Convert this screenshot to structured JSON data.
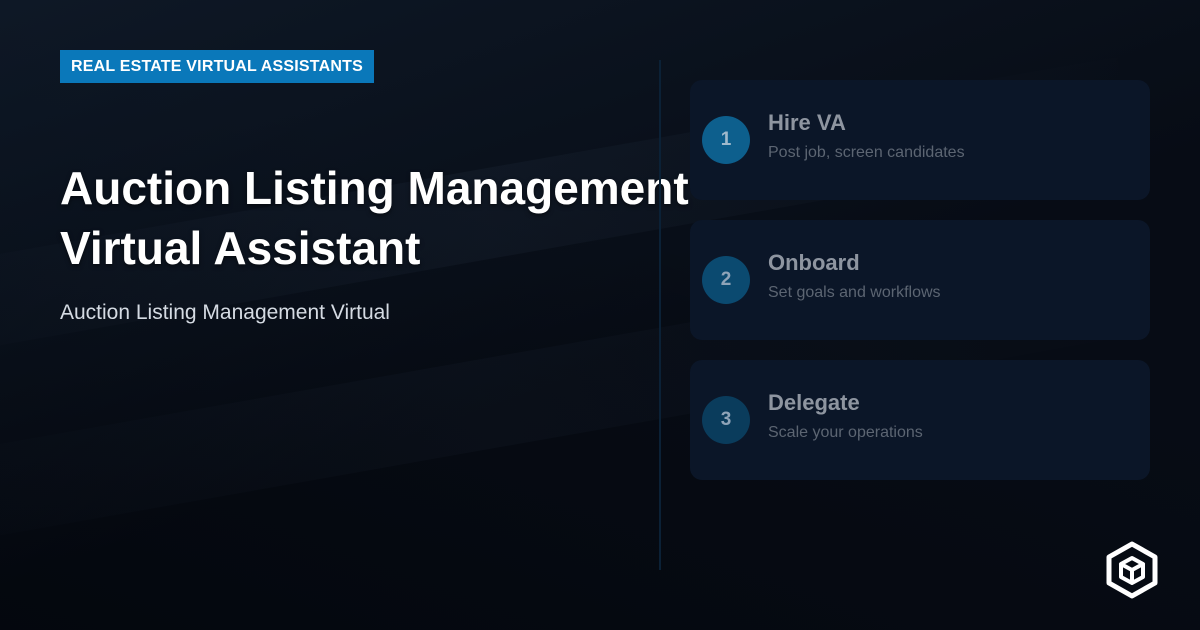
{
  "badge": "REAL ESTATE VIRTUAL ASSISTANTS",
  "title": "Auction Listing Management Virtual Assistant",
  "subtitle": "Auction Listing Management Virtual",
  "steps": [
    {
      "number": "1",
      "title": "Hire VA",
      "description": "Post job, screen candidates"
    },
    {
      "number": "2",
      "title": "Onboard",
      "description": "Set goals and workflows"
    },
    {
      "number": "3",
      "title": "Delegate",
      "description": "Scale your operations"
    }
  ],
  "colors": {
    "accent": "#0a78ba",
    "background": "#070c15",
    "card": "#0b1628",
    "step_circles": [
      "#0d5f8d",
      "#0b4a70",
      "#0a3c5c"
    ]
  },
  "icons": {
    "logo": "hexagon-cube-logo-icon"
  }
}
